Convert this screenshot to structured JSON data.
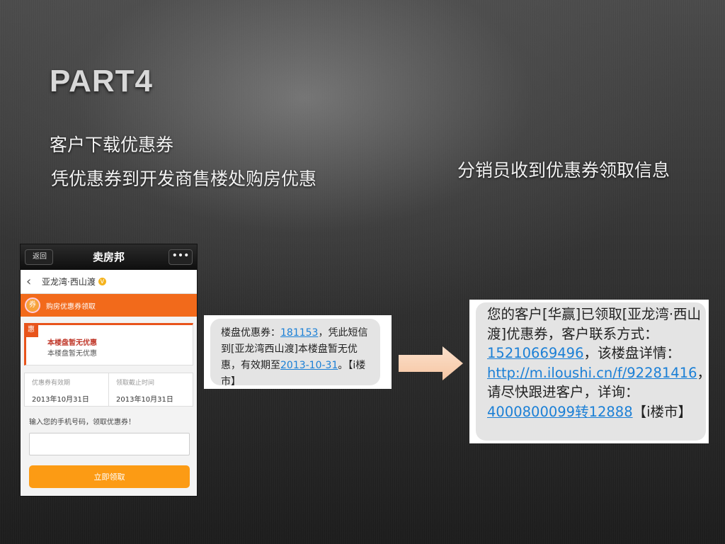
{
  "slide": {
    "title": "PART4",
    "line1": "客户下载优惠券",
    "line2": "凭优惠券到开发商售楼处购房优惠",
    "line3": "分销员收到优惠券领取信息"
  },
  "phone": {
    "back_label": "返回",
    "app_title": "卖房邦",
    "more_label": "•••",
    "project_name": "亚龙湾·西山渡",
    "badge": "V",
    "coupon_icon": "券",
    "coupon_section": "购房优惠券领取",
    "card_tag": "惠",
    "card_title": "本楼盘暂无优惠",
    "card_subtitle": "本楼盘暂无优惠",
    "valid_label": "优惠券有效期",
    "valid_value": "2013年10月31日",
    "deadline_label": "领取截止时间",
    "deadline_value": "2013年10月31日",
    "phone_prompt": "输入您的手机号码，领取优惠券！",
    "phone_value": "",
    "submit_label": "立即领取"
  },
  "sms1": {
    "p1": "楼盘优惠券：",
    "code": "181153",
    "p2": "，凭此短信到[亚龙湾西山渡]本楼盘暂无优惠，有效期至",
    "date": "2013-10-31",
    "p3": "。【i楼市】"
  },
  "sms2": {
    "p1": "您的客户[华赢]已领取[亚龙湾·西山渡]优惠券，客户联系方式：",
    "phone": "15210669496",
    "p2": "，该楼盘详情：",
    "url": "http://m.iloushi.cn/f/92281416",
    "p3": "，请尽快跟进客户，详询：",
    "hotline": "4000800099转12888",
    "p4": "【i楼市】"
  },
  "colors": {
    "accent_orange": "#f26a1b",
    "button_orange": "#fc9b14",
    "link_blue": "#1a7fd6",
    "arrow_fill": "#f9d2b4"
  }
}
